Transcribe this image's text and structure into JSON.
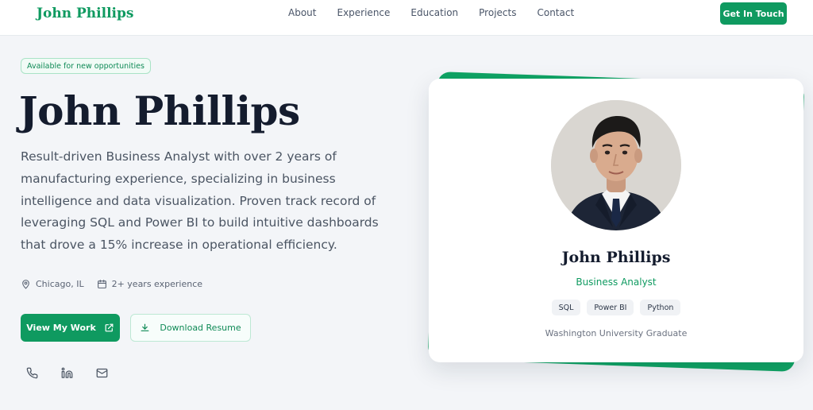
{
  "nav": {
    "brand": "John Phillips",
    "links": [
      "About",
      "Experience",
      "Education",
      "Projects",
      "Contact"
    ],
    "cta": "Get In Touch"
  },
  "hero": {
    "badge": "Available for new opportunities",
    "name": "John Phillips",
    "description": "Result-driven Business Analyst with over 2 years of manufacturing experience, specializing in business intelligence and data visualization. Proven track record of leveraging SQL and Power BI to build intuitive dashboards that drove a 15% increase in operational efficiency.",
    "location": "Chicago, IL",
    "experience": "2+ years experience",
    "primary_button": "View My Work",
    "secondary_button": "Download Resume",
    "socials": [
      "phone-icon",
      "linkedin-icon",
      "mail-icon"
    ]
  },
  "card": {
    "name": "John Phillips",
    "role": "Business Analyst",
    "skills": [
      "SQL",
      "Power BI",
      "Python"
    ],
    "education": "Washington University Graduate"
  },
  "colors": {
    "accent": "#0f9a60",
    "heading": "#141c2e",
    "background": "#f3f5f8"
  }
}
